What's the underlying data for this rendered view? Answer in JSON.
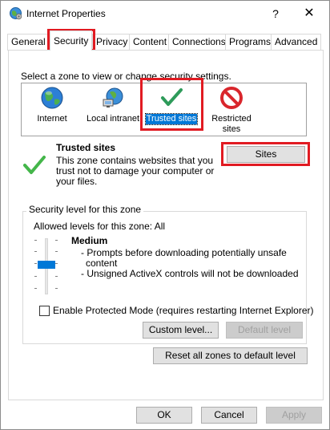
{
  "window": {
    "title": "Internet Properties",
    "help_glyph": "?",
    "close_glyph": "✕"
  },
  "tabs": [
    {
      "label": "General"
    },
    {
      "label": "Security",
      "active": true
    },
    {
      "label": "Privacy"
    },
    {
      "label": "Content"
    },
    {
      "label": "Connections"
    },
    {
      "label": "Programs"
    },
    {
      "label": "Advanced"
    }
  ],
  "zone_prompt": "Select a zone to view or change security settings.",
  "zones": [
    {
      "label": "Internet",
      "icon": "globe-icon"
    },
    {
      "label": "Local intranet",
      "icon": "network-icon"
    },
    {
      "label": "Trusted sites",
      "icon": "checkmark-icon",
      "selected": true
    },
    {
      "label": "Restricted sites",
      "label_line1": "Restricted",
      "label_line2": "sites",
      "icon": "restricted-icon"
    }
  ],
  "zone_info": {
    "title": "Trusted sites",
    "description_line1": "This zone contains websites that you",
    "description_line2": "trust not to damage your computer or",
    "description_line3": "your files.",
    "sites_button": "Sites"
  },
  "security_level": {
    "group_label": "Security level for this zone",
    "allowed_levels": "Allowed levels for this zone: All",
    "level_name": "Medium",
    "bullet1_line1": "- Prompts before downloading potentially unsafe",
    "bullet1_line2": "content",
    "bullet2": "- Unsigned ActiveX controls will not be downloaded",
    "slider_level_index": 2,
    "slider_levels_total": 5,
    "protected_mode_label": "Enable Protected Mode (requires restarting Internet Explorer)",
    "protected_mode_checked": false,
    "custom_level_button": "Custom level...",
    "default_level_button": "Default level"
  },
  "reset_all_button": "Reset all zones to default level",
  "footer": {
    "ok": "OK",
    "cancel": "Cancel",
    "apply": "Apply"
  },
  "colors": {
    "highlight_red": "#e11b22",
    "selection_blue": "#0078d7",
    "check_green": "#2ea043"
  }
}
